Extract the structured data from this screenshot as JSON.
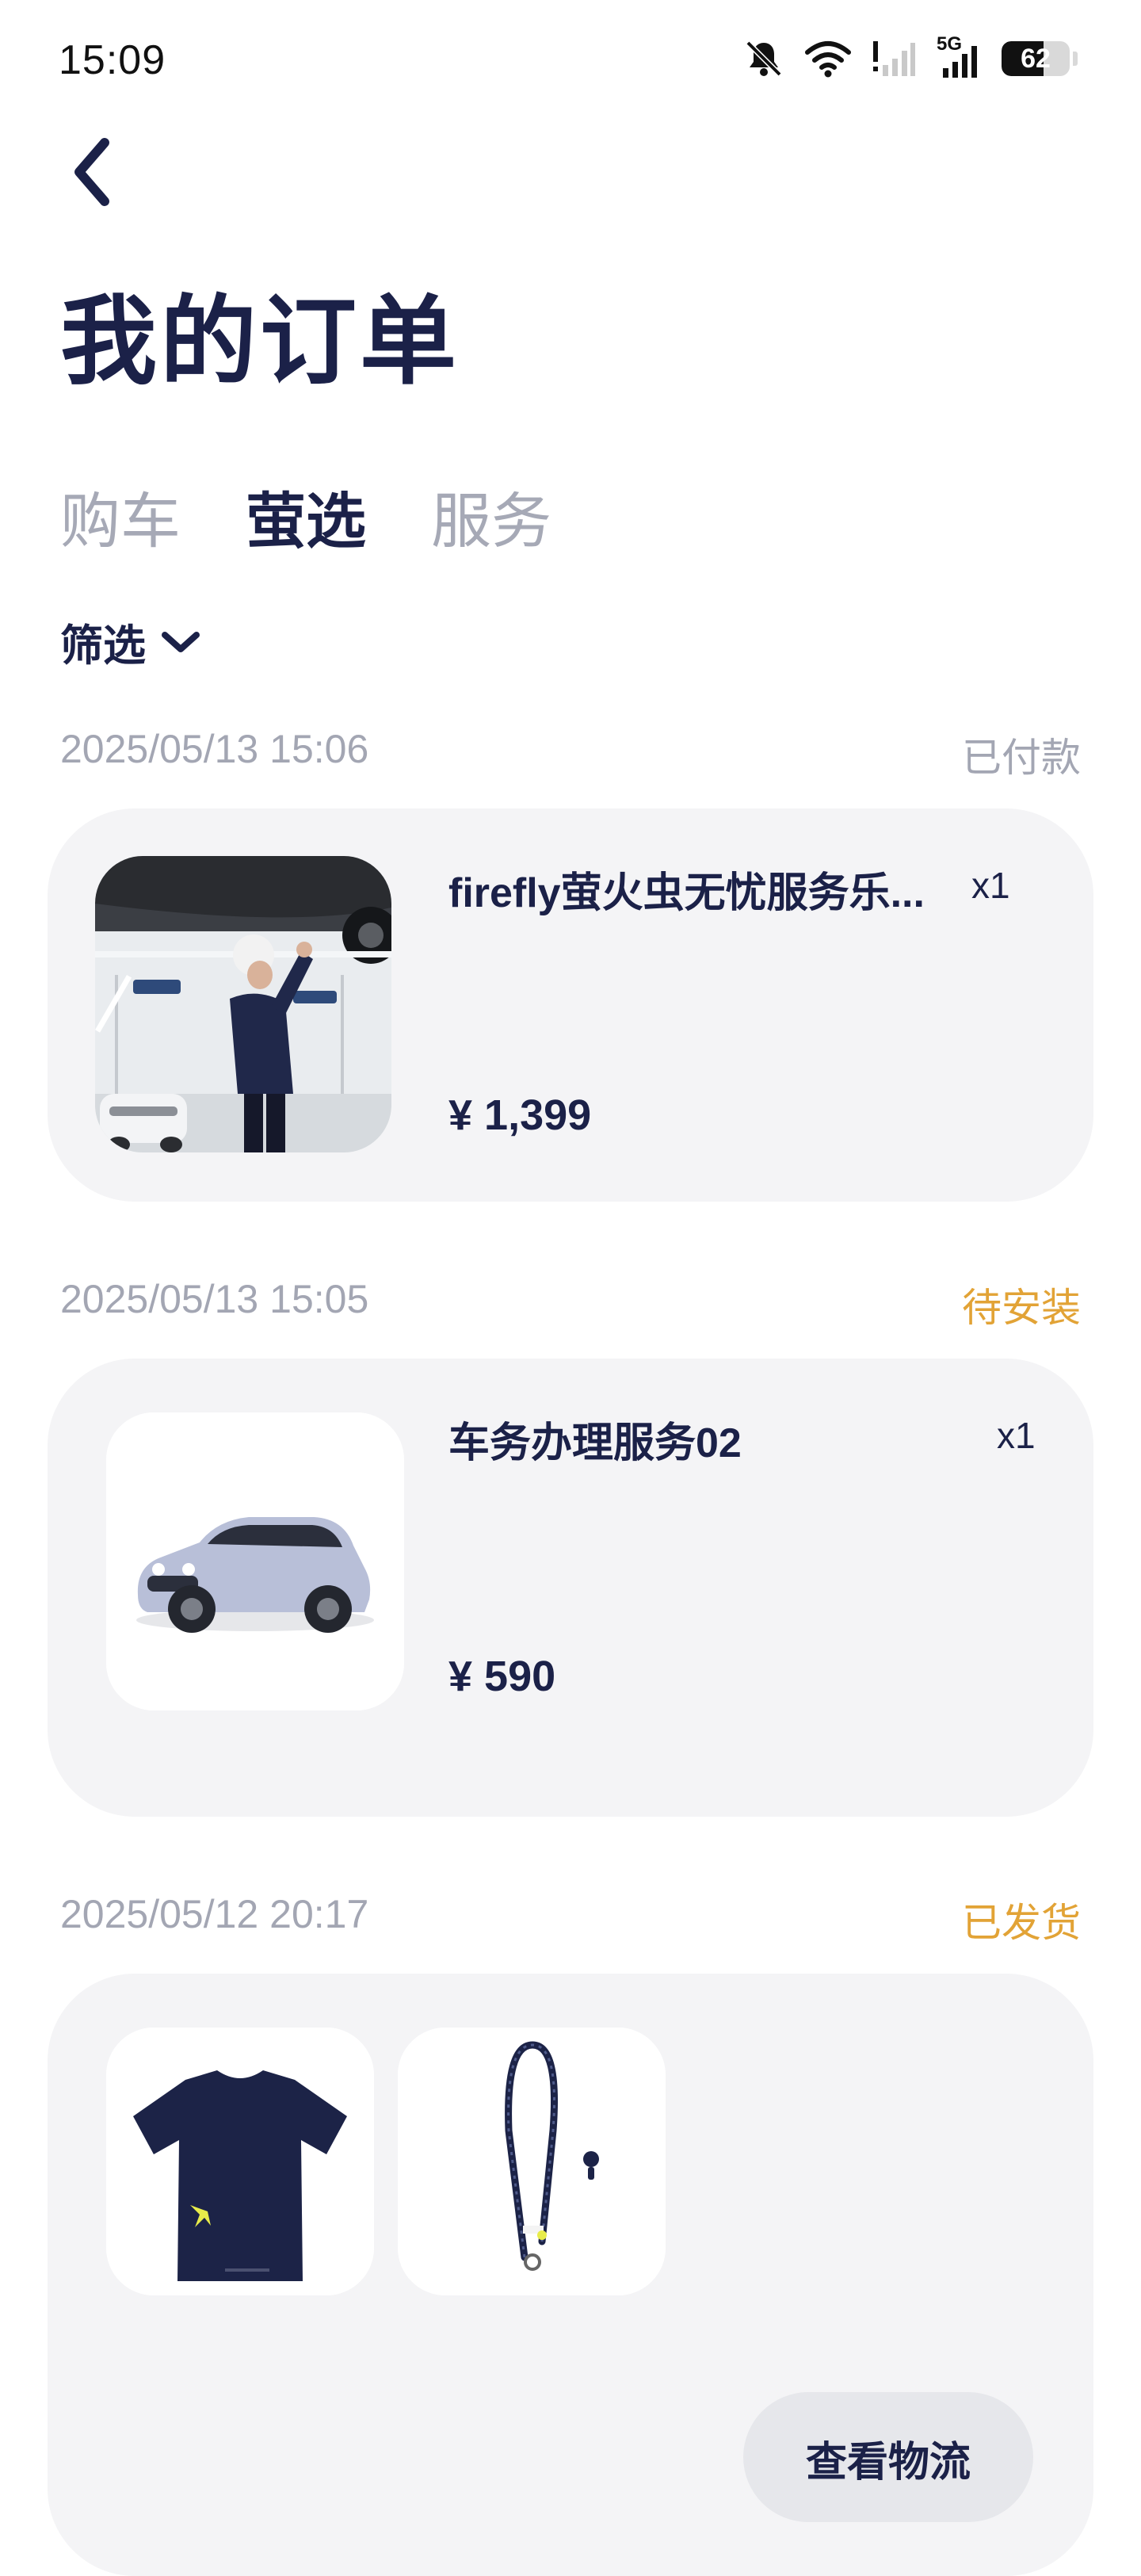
{
  "status_bar": {
    "time": "15:09",
    "icons": [
      "mute-icon",
      "wifi-icon",
      "sim1-signal-icon",
      "5g-signal-icon",
      "battery-icon"
    ],
    "network_label": "5G",
    "battery_level": "62",
    "battery_fraction": 0.62
  },
  "header": {
    "back_icon": "chevron-left-icon",
    "title": "我的订单"
  },
  "tabs": [
    {
      "label": "购车",
      "active": false
    },
    {
      "label": "萤选",
      "active": true
    },
    {
      "label": "服务",
      "active": false
    }
  ],
  "filter": {
    "label": "筛选",
    "icon": "chevron-down-icon"
  },
  "orders": [
    {
      "date": "2025/05/13 15:06",
      "status": "已付款",
      "status_color": "#a3a6b3",
      "items": [
        {
          "name": "firefly萤火虫无忧服务乐...",
          "qty": "x1",
          "price": "¥ 1,399",
          "image": "technician-under-car-photo"
        }
      ]
    },
    {
      "date": "2025/05/13 15:05",
      "status": "待安装",
      "status_color": "#e2a336",
      "items": [
        {
          "name": "车务办理服务02",
          "qty": "x1",
          "price": "¥ 590",
          "image": "compact-suv-car-photo"
        }
      ]
    },
    {
      "date": "2025/05/12 20:17",
      "status": "已发货",
      "status_color": "#e2a336",
      "items": [
        {
          "image": "navy-tshirt-photo"
        },
        {
          "image": "phone-lanyard-photo"
        }
      ],
      "action_label": "查看物流"
    }
  ],
  "colors": {
    "primary": "#1b2148",
    "muted": "#a3a6b3",
    "warning": "#e2a336",
    "card_bg": "#f4f4f6"
  }
}
